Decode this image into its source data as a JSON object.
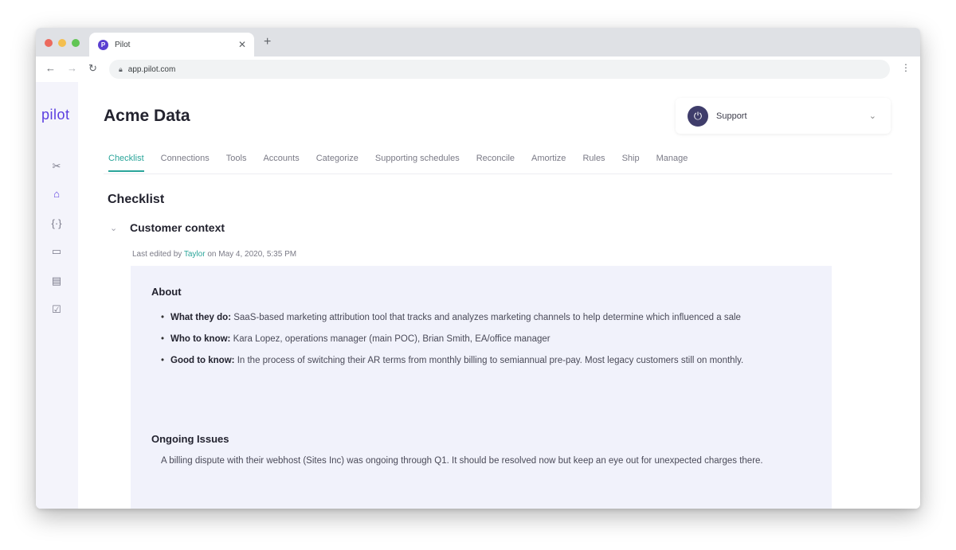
{
  "browser": {
    "tab_title": "Pilot",
    "favicon_letter": "P",
    "url": "app.pilot.com"
  },
  "sidebar": {
    "logo": "pilot",
    "icons": [
      "tools-icon",
      "camera-icon",
      "code-icon",
      "building-icon",
      "card-icon",
      "report-icon"
    ]
  },
  "header": {
    "title": "Acme Data",
    "support_label": "Support"
  },
  "tabs": [
    {
      "label": "Checklist",
      "active": true
    },
    {
      "label": "Connections"
    },
    {
      "label": "Tools"
    },
    {
      "label": "Accounts"
    },
    {
      "label": "Categorize"
    },
    {
      "label": "Supporting schedules"
    },
    {
      "label": "Reconcile"
    },
    {
      "label": "Amortize"
    },
    {
      "label": "Rules"
    },
    {
      "label": "Ship"
    },
    {
      "label": "Manage"
    }
  ],
  "checklist": {
    "title": "Checklist",
    "section_title": "Customer context",
    "edited_prefix": "Last edited by",
    "edited_author": "Taylor",
    "edited_suffix": "on May 4, 2020, 5:35 PM",
    "about_title": "About",
    "bullets": [
      {
        "key": "What they do:",
        "text": "SaaS-based marketing attribution tool that tracks and analyzes marketing channels to help determine which influenced a sale"
      },
      {
        "key": "Who to know:",
        "text": "Kara Lopez, operations manager (main POC), Brian Smith, EA/office manager"
      },
      {
        "key": "Good to know:",
        "text": "In the process of switching their AR terms from monthly billing to semiannual pre-pay. Most legacy customers still on monthly."
      }
    ],
    "issues_title": "Ongoing Issues",
    "issues_text": "A billing dispute with their webhost (Sites Inc) was ongoing through Q1. It should be resolved now but keep an eye out for unexpected charges there."
  },
  "colors": {
    "accent": "#2aa59a",
    "brand": "#5b3ee0",
    "card_bg": "#f1f2fb"
  }
}
